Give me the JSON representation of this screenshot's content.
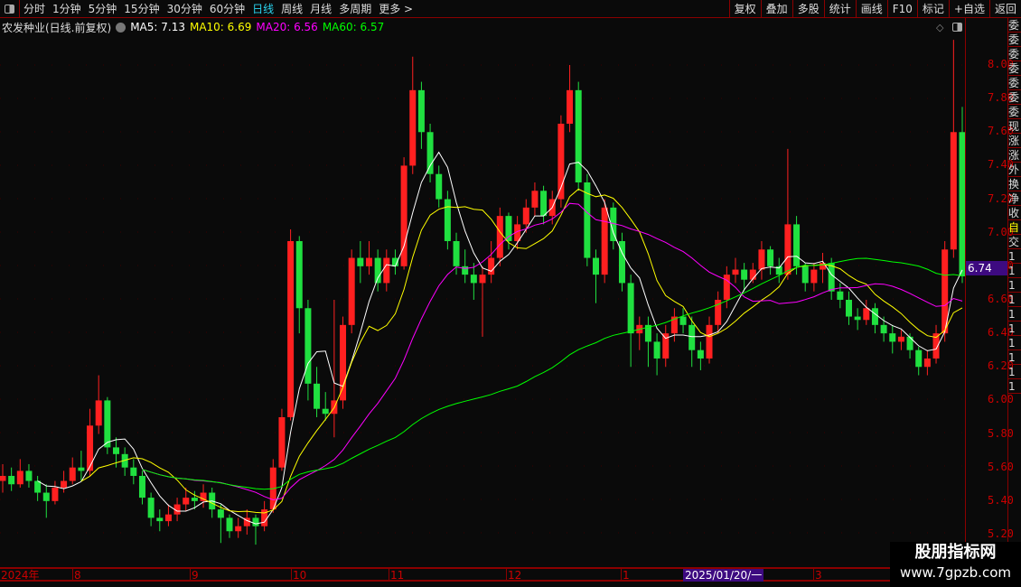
{
  "toolbar": {
    "tabs": [
      "分时",
      "1分钟",
      "5分钟",
      "15分钟",
      "30分钟",
      "60分钟",
      "日线",
      "周线",
      "月线",
      "多周期",
      "更多 >"
    ],
    "active": "日线",
    "right_buttons": [
      "复权",
      "叠加",
      "多股",
      "统计",
      "画线",
      "F10",
      "标记",
      "+自选",
      "返回"
    ]
  },
  "info": {
    "title": "农发种业(日线.前复权)",
    "ma5": "MA5: 7.13",
    "ma10": "MA10: 6.69",
    "ma20": "MA20: 6.56",
    "ma60": "MA60: 6.57"
  },
  "colors": {
    "up": "#ff2020",
    "down": "#20e040",
    "ma5": "#ffffff",
    "ma10": "#ffff00",
    "ma20": "#ff00ff",
    "ma60": "#00ff00",
    "axis": "#8b0000",
    "highlight": "#3d0a80"
  },
  "right_panel": [
    "委",
    "委",
    "委",
    "委",
    "委",
    "委",
    "委",
    "现",
    "涨",
    "涨",
    "外",
    "换",
    "净",
    "收",
    "自",
    "交",
    "1",
    "1",
    "1",
    "1",
    "1",
    "1",
    "1",
    "1",
    "1",
    "1"
  ],
  "price_tag": "6.74",
  "watermark": {
    "line1": "股朋指标网",
    "line2": "www.7gpzb.com"
  },
  "chart_data": {
    "type": "candlestick",
    "ylim": [
      5.1,
      8.2
    ],
    "yticks": [
      "8.00",
      "7.80",
      "7.60",
      "7.40",
      "7.20",
      "7.00",
      "6.80",
      "6.60",
      "6.40",
      "6.20",
      "6.00",
      "5.80",
      "5.60",
      "5.40",
      "5.20"
    ],
    "xticks": [
      "2024年",
      "8",
      "9",
      "10",
      "11",
      "12",
      "1",
      "3"
    ],
    "selected_date": "2025/01/20/一",
    "ohlc": [
      [
        5.52,
        5.62,
        5.45,
        5.55
      ],
      [
        5.55,
        5.6,
        5.46,
        5.5
      ],
      [
        5.5,
        5.65,
        5.48,
        5.58
      ],
      [
        5.58,
        5.62,
        5.48,
        5.52
      ],
      [
        5.52,
        5.55,
        5.4,
        5.45
      ],
      [
        5.45,
        5.5,
        5.3,
        5.4
      ],
      [
        5.4,
        5.52,
        5.38,
        5.48
      ],
      [
        5.48,
        5.58,
        5.45,
        5.52
      ],
      [
        5.52,
        5.66,
        5.5,
        5.6
      ],
      [
        5.6,
        5.7,
        5.52,
        5.58
      ],
      [
        5.58,
        5.95,
        5.55,
        5.85
      ],
      [
        5.85,
        6.15,
        5.8,
        6.0
      ],
      [
        6.0,
        6.02,
        5.68,
        5.72
      ],
      [
        5.72,
        5.78,
        5.6,
        5.68
      ],
      [
        5.68,
        5.72,
        5.55,
        5.6
      ],
      [
        5.6,
        5.65,
        5.5,
        5.55
      ],
      [
        5.55,
        5.58,
        5.38,
        5.42
      ],
      [
        5.42,
        5.45,
        5.25,
        5.3
      ],
      [
        5.3,
        5.35,
        5.22,
        5.28
      ],
      [
        5.28,
        5.38,
        5.25,
        5.32
      ],
      [
        5.32,
        5.42,
        5.28,
        5.38
      ],
      [
        5.38,
        5.48,
        5.34,
        5.42
      ],
      [
        5.42,
        5.46,
        5.35,
        5.4
      ],
      [
        5.4,
        5.5,
        5.36,
        5.45
      ],
      [
        5.45,
        5.48,
        5.3,
        5.35
      ],
      [
        5.35,
        5.38,
        5.15,
        5.3
      ],
      [
        5.3,
        5.32,
        5.18,
        5.22
      ],
      [
        5.22,
        5.3,
        5.18,
        5.25
      ],
      [
        5.25,
        5.35,
        5.2,
        5.3
      ],
      [
        5.3,
        5.32,
        5.14,
        5.25
      ],
      [
        5.25,
        5.4,
        5.22,
        5.35
      ],
      [
        5.35,
        5.65,
        5.33,
        5.6
      ],
      [
        5.6,
        5.95,
        5.58,
        5.9
      ],
      [
        5.9,
        7.02,
        5.88,
        6.95
      ],
      [
        6.95,
        6.98,
        6.4,
        6.55
      ],
      [
        6.55,
        6.6,
        6.0,
        6.1
      ],
      [
        6.1,
        6.2,
        5.9,
        5.95
      ],
      [
        5.95,
        6.05,
        5.88,
        5.92
      ],
      [
        5.92,
        6.6,
        5.78,
        6.0
      ],
      [
        6.0,
        6.5,
        5.95,
        6.45
      ],
      [
        6.45,
        6.9,
        6.4,
        6.85
      ],
      [
        6.85,
        6.95,
        6.7,
        6.8
      ],
      [
        6.8,
        6.95,
        6.75,
        6.85
      ],
      [
        6.85,
        6.9,
        6.65,
        6.7
      ],
      [
        6.7,
        6.9,
        6.65,
        6.85
      ],
      [
        6.85,
        6.9,
        6.75,
        6.8
      ],
      [
        6.8,
        7.45,
        6.78,
        7.4
      ],
      [
        7.4,
        8.05,
        7.35,
        7.85
      ],
      [
        7.85,
        7.9,
        7.5,
        7.6
      ],
      [
        7.6,
        7.65,
        7.3,
        7.35
      ],
      [
        7.35,
        7.4,
        7.15,
        7.2
      ],
      [
        7.2,
        7.25,
        6.9,
        6.95
      ],
      [
        6.95,
        7.0,
        6.75,
        6.8
      ],
      [
        6.8,
        6.9,
        6.7,
        6.75
      ],
      [
        6.75,
        6.82,
        6.6,
        6.7
      ],
      [
        6.7,
        6.8,
        6.38,
        6.75
      ],
      [
        6.75,
        6.95,
        6.7,
        6.85
      ],
      [
        6.85,
        7.15,
        6.8,
        7.1
      ],
      [
        7.1,
        7.12,
        6.9,
        6.95
      ],
      [
        6.95,
        7.1,
        6.9,
        7.05
      ],
      [
        7.05,
        7.2,
        7.0,
        7.15
      ],
      [
        7.15,
        7.3,
        7.1,
        7.25
      ],
      [
        7.25,
        7.28,
        7.05,
        7.1
      ],
      [
        7.1,
        7.25,
        7.05,
        7.2
      ],
      [
        7.2,
        7.7,
        7.15,
        7.65
      ],
      [
        7.65,
        8.0,
        7.6,
        7.85
      ],
      [
        7.85,
        7.9,
        7.25,
        7.3
      ],
      [
        7.3,
        7.35,
        6.8,
        6.85
      ],
      [
        6.85,
        6.9,
        6.58,
        6.75
      ],
      [
        6.75,
        7.2,
        6.7,
        7.15
      ],
      [
        7.15,
        7.18,
        6.9,
        6.95
      ],
      [
        6.95,
        7.0,
        6.65,
        6.7
      ],
      [
        6.7,
        6.75,
        6.2,
        6.4
      ],
      [
        6.4,
        6.5,
        6.3,
        6.45
      ],
      [
        6.45,
        6.5,
        6.2,
        6.35
      ],
      [
        6.35,
        6.4,
        6.15,
        6.25
      ],
      [
        6.25,
        6.45,
        6.2,
        6.4
      ],
      [
        6.4,
        6.55,
        6.35,
        6.5
      ],
      [
        6.5,
        6.55,
        6.4,
        6.45
      ],
      [
        6.45,
        6.5,
        6.2,
        6.3
      ],
      [
        6.3,
        6.35,
        6.18,
        6.25
      ],
      [
        6.25,
        6.5,
        6.22,
        6.45
      ],
      [
        6.45,
        6.65,
        6.4,
        6.6
      ],
      [
        6.6,
        6.8,
        6.55,
        6.75
      ],
      [
        6.75,
        6.85,
        6.7,
        6.78
      ],
      [
        6.78,
        6.82,
        6.65,
        6.72
      ],
      [
        6.72,
        6.82,
        6.7,
        6.78
      ],
      [
        6.78,
        6.95,
        6.72,
        6.9
      ],
      [
        6.9,
        6.92,
        6.75,
        6.8
      ],
      [
        6.8,
        6.85,
        6.7,
        6.75
      ],
      [
        6.75,
        7.5,
        6.72,
        7.05
      ],
      [
        7.05,
        7.1,
        6.75,
        6.8
      ],
      [
        6.8,
        6.82,
        6.65,
        6.7
      ],
      [
        6.7,
        6.82,
        6.65,
        6.78
      ],
      [
        6.78,
        6.88,
        6.7,
        6.82
      ],
      [
        6.82,
        6.85,
        6.6,
        6.65
      ],
      [
        6.65,
        6.7,
        6.55,
        6.6
      ],
      [
        6.6,
        6.65,
        6.45,
        6.5
      ],
      [
        6.5,
        6.55,
        6.42,
        6.48
      ],
      [
        6.48,
        6.6,
        6.45,
        6.55
      ],
      [
        6.55,
        6.58,
        6.4,
        6.45
      ],
      [
        6.45,
        6.5,
        6.35,
        6.4
      ],
      [
        6.4,
        6.45,
        6.28,
        6.35
      ],
      [
        6.35,
        6.42,
        6.3,
        6.38
      ],
      [
        6.38,
        6.4,
        6.25,
        6.3
      ],
      [
        6.3,
        6.32,
        6.15,
        6.2
      ],
      [
        6.2,
        6.3,
        6.15,
        6.25
      ],
      [
        6.25,
        6.45,
        6.22,
        6.4
      ],
      [
        6.4,
        6.95,
        6.35,
        6.9
      ],
      [
        6.9,
        8.15,
        6.85,
        7.6
      ],
      [
        7.6,
        7.75,
        6.7,
        6.74
      ]
    ]
  }
}
